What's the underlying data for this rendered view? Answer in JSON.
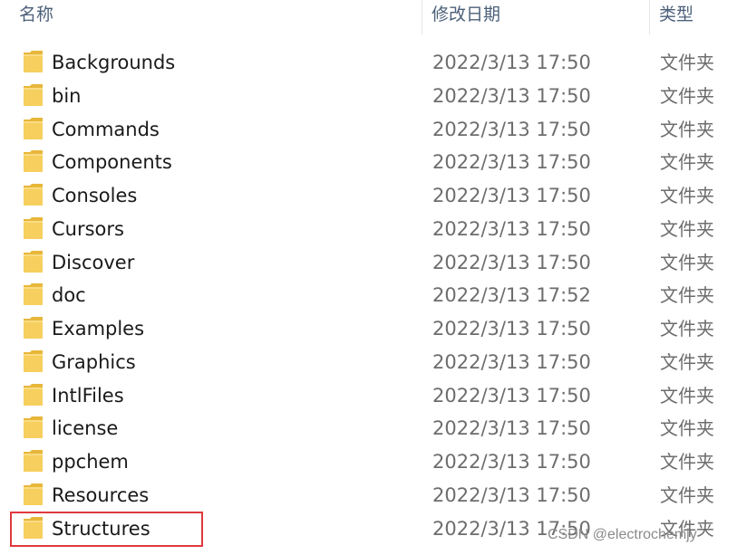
{
  "columns": {
    "name": "名称",
    "date_modified": "修改日期",
    "type": "类型"
  },
  "folder_icon_color": "#f6cf5e",
  "items": [
    {
      "name": "Backgrounds",
      "date": "2022/3/13 17:50",
      "type": "文件夹"
    },
    {
      "name": "bin",
      "date": "2022/3/13 17:50",
      "type": "文件夹"
    },
    {
      "name": "Commands",
      "date": "2022/3/13 17:50",
      "type": "文件夹"
    },
    {
      "name": "Components",
      "date": "2022/3/13 17:50",
      "type": "文件夹"
    },
    {
      "name": "Consoles",
      "date": "2022/3/13 17:50",
      "type": "文件夹"
    },
    {
      "name": "Cursors",
      "date": "2022/3/13 17:50",
      "type": "文件夹"
    },
    {
      "name": "Discover",
      "date": "2022/3/13 17:50",
      "type": "文件夹"
    },
    {
      "name": "doc",
      "date": "2022/3/13 17:52",
      "type": "文件夹"
    },
    {
      "name": "Examples",
      "date": "2022/3/13 17:50",
      "type": "文件夹"
    },
    {
      "name": "Graphics",
      "date": "2022/3/13 17:50",
      "type": "文件夹"
    },
    {
      "name": "IntlFiles",
      "date": "2022/3/13 17:50",
      "type": "文件夹"
    },
    {
      "name": "license",
      "date": "2022/3/13 17:50",
      "type": "文件夹"
    },
    {
      "name": "ppchem",
      "date": "2022/3/13 17:50",
      "type": "文件夹"
    },
    {
      "name": "Resources",
      "date": "2022/3/13 17:50",
      "type": "文件夹"
    },
    {
      "name": "Structures",
      "date": "2022/3/13 17:50",
      "type": "文件夹"
    }
  ],
  "highlighted_item": "Structures",
  "highlight_color": "#e0393e",
  "watermark": "CSDN @electrochemjy"
}
